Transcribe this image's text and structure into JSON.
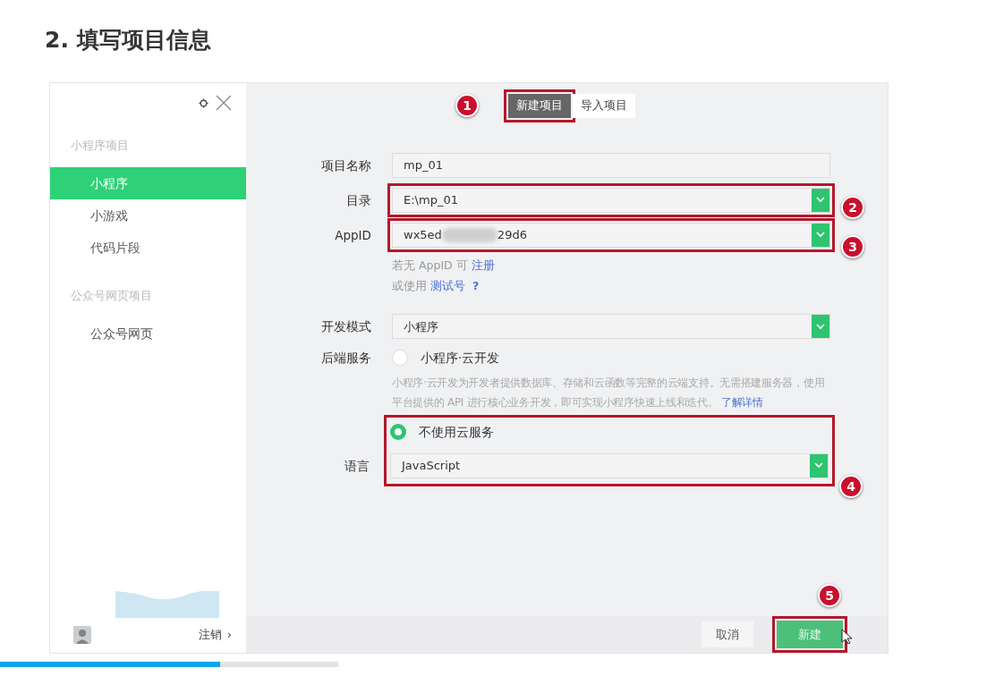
{
  "title": "2. 填写项目信息",
  "sidebar": {
    "groups": [
      {
        "heading": "小程序项目",
        "items": [
          {
            "label": "小程序",
            "selected": true
          },
          {
            "label": "小游戏",
            "selected": false
          },
          {
            "label": "代码片段",
            "selected": false
          }
        ]
      },
      {
        "heading": "公众号网页项目",
        "items": [
          {
            "label": "公众号网页",
            "selected": false
          }
        ]
      }
    ],
    "logout": "注销",
    "logout_arrow": "›"
  },
  "tabs": [
    {
      "label": "新建项目",
      "selected": true,
      "step": "1"
    },
    {
      "label": "导入项目",
      "selected": false
    }
  ],
  "fields": [
    {
      "kind": "text",
      "label": "项目名称",
      "value": "mp_01"
    },
    {
      "kind": "select",
      "label": "目录",
      "value": "E:\\mp_01",
      "step": "2"
    },
    {
      "kind": "select",
      "label": "AppID",
      "value": "wx5ed",
      "value_end": "29d6",
      "redacted": true,
      "step": "3"
    }
  ],
  "appid_hints": [
    {
      "text": "若无 AppID 可",
      "link": "注册"
    },
    {
      "text": "或使用",
      "link": "测试号",
      "help": "?"
    }
  ],
  "mode": {
    "label": "开发模式",
    "value": "小程序"
  },
  "backend": {
    "label": "后端服务",
    "options": [
      {
        "label": "小程序·云开发",
        "selected": false,
        "description": "小程序·云开发为开发者提供数据库、存储和云函数等完整的云端支持。无需搭建服务器，使用平台提供的 API 进行核心业务开发，即可实现小程序快速上线和迭代。",
        "link": "了解详情"
      },
      {
        "label": "不使用云服务",
        "selected": true,
        "step": "4"
      }
    ]
  },
  "language": {
    "label": "语言",
    "value": "JavaScript"
  },
  "buttons": [
    {
      "kind": "cancel",
      "label": "取消"
    },
    {
      "kind": "primary",
      "label": "新建",
      "step": "5"
    }
  ],
  "video_progress": {
    "level": 0.65
  }
}
